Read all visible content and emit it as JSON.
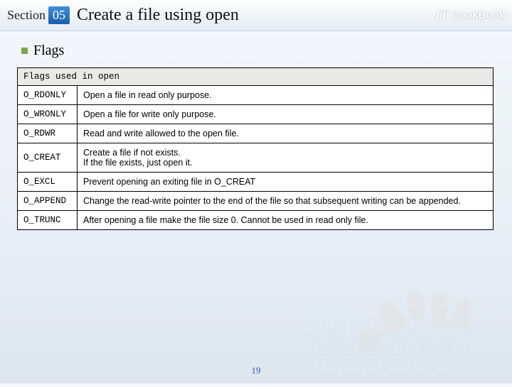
{
  "header": {
    "section_label": "Section",
    "section_number": "05",
    "title": "Create a file using open",
    "brand_it": "IT",
    "brand_name": "CookBook"
  },
  "subheading": "Flags",
  "table": {
    "header": "Flags used in open",
    "rows": [
      {
        "flag": "O_RDONLY",
        "desc": "Open a file in read only purpose."
      },
      {
        "flag": "O_WRONLY",
        "desc": "Open a file for write only purpose."
      },
      {
        "flag": "O_RDWR",
        "desc": "Read and write allowed to the open file."
      },
      {
        "flag": "O_CREAT",
        "desc": "Create a file if not exists.\nIf the file exists, just open it."
      },
      {
        "flag": "O_EXCL",
        "desc": "Prevent opening an exiting file in O_CREAT"
      },
      {
        "flag": "O_APPEND",
        "desc": "Change the read-write pointer to the end of the file so that subsequent writing can be appended."
      },
      {
        "flag": "O_TRUNC",
        "desc": "After opening a file make the file size 0. Cannot be used in read only file."
      }
    ]
  },
  "page_number": "19"
}
